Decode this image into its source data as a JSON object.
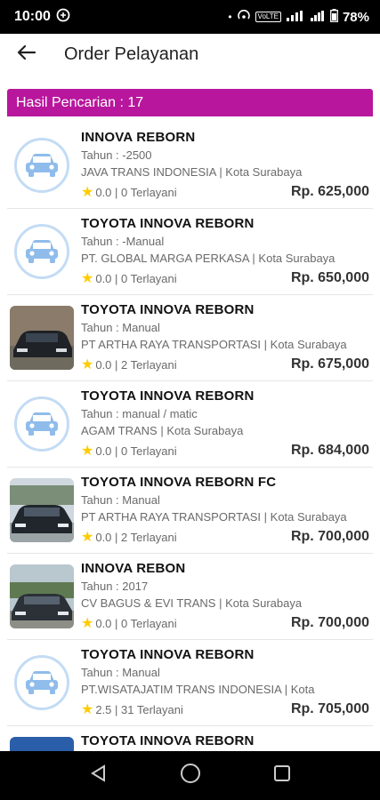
{
  "status_bar": {
    "time": "10:00",
    "battery": "78%",
    "volte": "VoLTE"
  },
  "app_bar": {
    "title": "Order Pelayanan"
  },
  "banner": {
    "label": "Hasil Pencarian : 17"
  },
  "items": [
    {
      "name": "INNOVA REBORN",
      "year": "Tahun : -2500",
      "vendor": " JAVA TRANS INDONESIA | Kota Surabaya",
      "rating": "0.0 | 0  Terlayani",
      "price": "Rp. 625,000",
      "thumb": "placeholder"
    },
    {
      "name": "TOYOTA INNOVA REBORN",
      "year": "Tahun : -Manual",
      "vendor": "PT. GLOBAL MARGA PERKASA  | Kota Surabaya",
      "rating": "0.0 | 0  Terlayani",
      "price": "Rp. 650,000",
      "thumb": "placeholder"
    },
    {
      "name": "TOYOTA INNOVA REBORN",
      "year": "Tahun : Manual",
      "vendor": "PT ARTHA RAYA TRANSPORTASI | Kota Surabaya",
      "rating": "0.0 | 2  Terlayani",
      "price": "Rp. 675,000",
      "thumb": "photo-dark"
    },
    {
      "name": "TOYOTA INNOVA REBORN",
      "year": "Tahun : manual / matic",
      "vendor": "AGAM TRANS | Kota Surabaya",
      "rating": "0.0 | 0  Terlayani",
      "price": "Rp. 684,000",
      "thumb": "placeholder"
    },
    {
      "name": "TOYOTA INNOVA REBORN FC",
      "year": "Tahun : Manual",
      "vendor": "PT ARTHA RAYA TRANSPORTASI | Kota Surabaya",
      "rating": "0.0 | 2  Terlayani",
      "price": "Rp. 700,000",
      "thumb": "photo-street"
    },
    {
      "name": "INNOVA REBON",
      "year": "Tahun : 2017",
      "vendor": "CV BAGUS & EVI TRANS  | Kota Surabaya",
      "rating": "0.0 | 0  Terlayani",
      "price": "Rp. 700,000",
      "thumb": "photo-outdoor"
    },
    {
      "name": "TOYOTA INNOVA REBORN",
      "year": "Tahun : Manual",
      "vendor": "PT.WISATAJATIM TRANS INDONESIA | Kota",
      "rating": "2.5 | 31  Terlayani",
      "price": "Rp. 705,000",
      "thumb": "placeholder"
    },
    {
      "name": "TOYOTA INNOVA REBORN",
      "year": "",
      "vendor": "",
      "rating": "",
      "price": "",
      "thumb": "photo-blue"
    }
  ],
  "colors": {
    "accent": "#b8169c",
    "placeholder_circle": "#c3dcf5",
    "placeholder_car": "#8fbceb",
    "star": "#ffcc00"
  },
  "icons": {
    "back": "arrow-left-icon",
    "car": "car-icon",
    "star": "star-icon",
    "nav_back": "triangle-back-icon",
    "nav_home": "circle-home-icon",
    "nav_recent": "square-recents-icon"
  }
}
